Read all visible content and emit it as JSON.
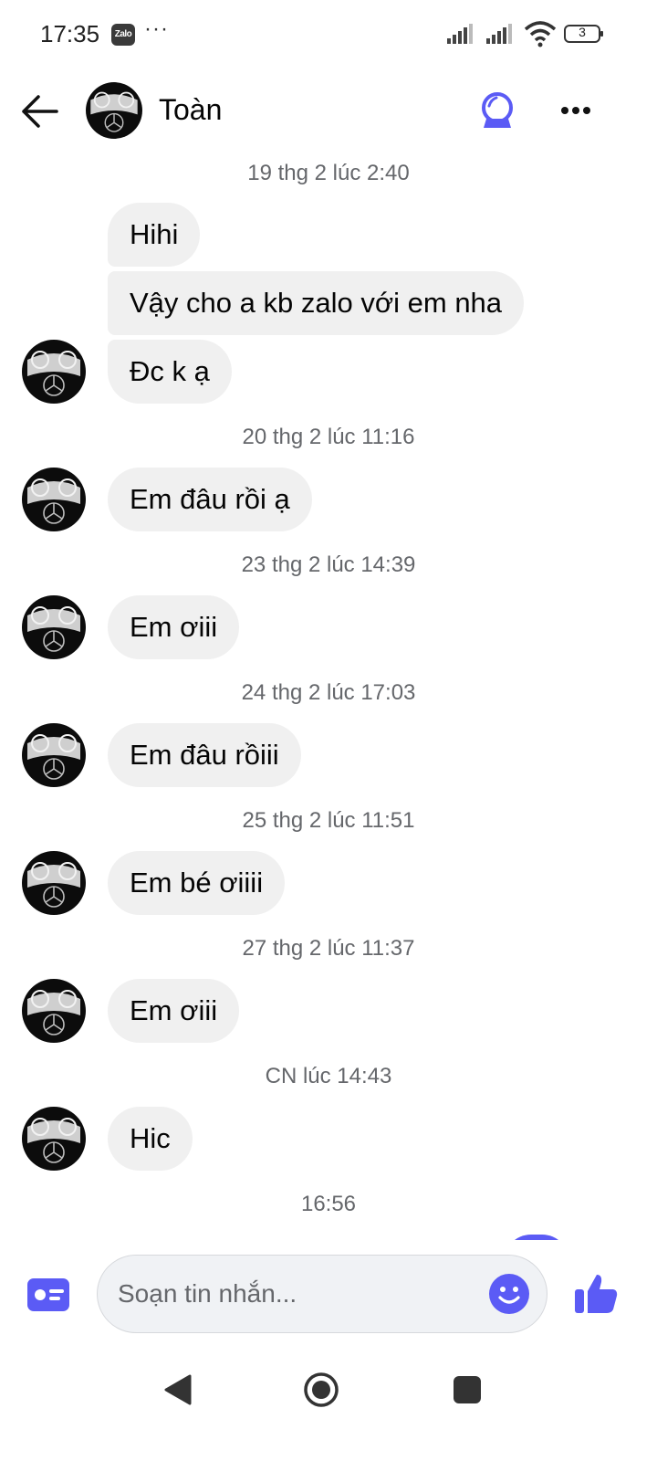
{
  "status_bar": {
    "time": "17:35",
    "app_badge": "Zalo",
    "more": "···",
    "battery": "3"
  },
  "header": {
    "contact_name": "Toàn"
  },
  "messages": [
    {
      "timestamp": "19 thg 2 lúc 2:40"
    },
    {
      "text": "Hihi"
    },
    {
      "text": "Vậy cho a kb zalo với em nha"
    },
    {
      "text": "Đc k ạ"
    },
    {
      "timestamp": "20 thg 2 lúc 11:16"
    },
    {
      "text": "Em đâu rồi ạ"
    },
    {
      "timestamp": "23 thg 2 lúc 14:39"
    },
    {
      "text": "Em ơiii"
    },
    {
      "timestamp": "24 thg 2 lúc 17:03"
    },
    {
      "text": "Em đâu rồiii"
    },
    {
      "timestamp": "25 thg 2 lúc 11:51"
    },
    {
      "text": "Em bé ơiiii"
    },
    {
      "timestamp": "27 thg 2 lúc 11:37"
    },
    {
      "text": "Em ơiii"
    },
    {
      "timestamp": "CN lúc 14:43"
    },
    {
      "text": "Hic"
    },
    {
      "timestamp": "16:56"
    }
  ],
  "composer": {
    "placeholder": "Soạn tin nhắn...",
    "value": ""
  },
  "icons": {
    "back": "arrow-left-icon",
    "magic": "crystal-ball-icon",
    "more": "more-horizontal-icon",
    "card": "contact-card-icon",
    "emoji": "emoji-icon",
    "like": "thumbs-up-icon"
  },
  "colors": {
    "accent": "#5b5bf5",
    "bubble_incoming": "#f0f0f0",
    "timestamp": "#65676b"
  }
}
